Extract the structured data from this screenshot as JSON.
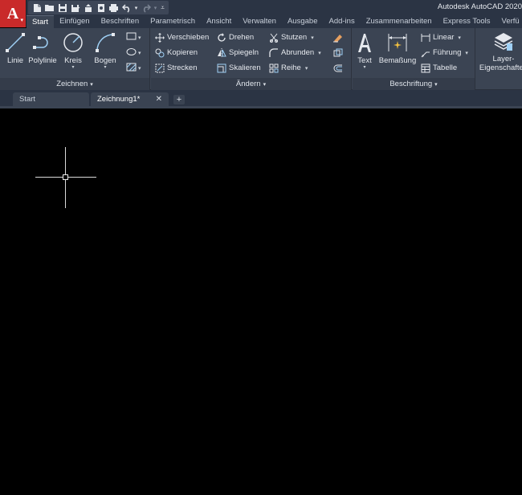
{
  "app": {
    "title": "Autodesk AutoCAD 2020",
    "accent": "#c92a2a"
  },
  "quick_access": [
    {
      "icon": "new-file-icon"
    },
    {
      "icon": "open-folder-icon"
    },
    {
      "icon": "save-icon"
    },
    {
      "icon": "save-as-icon"
    },
    {
      "icon": "upload-icon"
    },
    {
      "icon": "print-preview-icon"
    },
    {
      "icon": "print-icon"
    },
    {
      "icon": "undo-icon"
    },
    {
      "icon": "redo-icon"
    },
    {
      "icon": "customize-dropdown-icon"
    }
  ],
  "tabs": [
    {
      "label": "Start",
      "active": true
    },
    {
      "label": "Einfügen"
    },
    {
      "label": "Beschriften"
    },
    {
      "label": "Parametrisch"
    },
    {
      "label": "Ansicht"
    },
    {
      "label": "Verwalten"
    },
    {
      "label": "Ausgabe"
    },
    {
      "label": "Add-ins"
    },
    {
      "label": "Zusammenarbeiten"
    },
    {
      "label": "Express Tools"
    },
    {
      "label": "Verfü"
    }
  ],
  "panels": {
    "zeichnen": {
      "title": "Zeichnen",
      "linie": "Linie",
      "polylinie": "Polylinie",
      "kreis": "Kreis",
      "bogen": "Bogen"
    },
    "aendern": {
      "title": "Ändern",
      "verschieben": "Verschieben",
      "drehen": "Drehen",
      "stutzen": "Stutzen",
      "kopieren": "Kopieren",
      "spiegeln": "Spiegeln",
      "abrunden": "Abrunden",
      "strecken": "Strecken",
      "skalieren": "Skalieren",
      "reihe": "Reihe"
    },
    "beschriftung": {
      "title": "Beschriftung",
      "text": "Text",
      "bemassung": "Bemaßung",
      "linear": "Linear",
      "fuehrung": "Führung",
      "tabelle": "Tabelle"
    },
    "layer": {
      "label_line1": "Layer-",
      "label_line2": "Eigenschaften"
    }
  },
  "file_tabs": {
    "start": "Start",
    "drawing": "Zeichnung1*",
    "close": "✕",
    "add": "+"
  }
}
